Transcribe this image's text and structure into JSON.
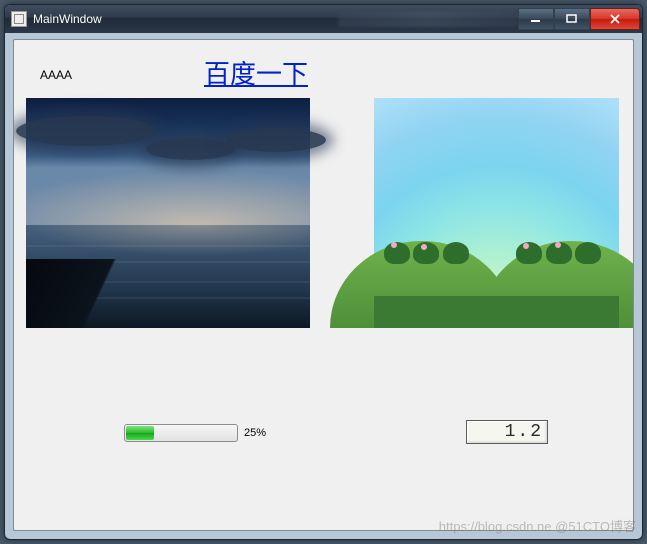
{
  "window": {
    "title": "MainWindow",
    "icons": {
      "app": "window-icon",
      "minimize": "minimize-icon",
      "maximize": "maximize-icon",
      "close": "close-icon"
    }
  },
  "labels": {
    "aaaa": "AAAA"
  },
  "link": {
    "text": "百度一下"
  },
  "images": {
    "left_alt": "sunset-over-water-photo",
    "right_alt": "cartoon-meadow-illustration"
  },
  "progress": {
    "value": 25,
    "max": 100,
    "text": "25%"
  },
  "lcd": {
    "value": "1.2"
  },
  "watermark": "https://blog.csdn.ne  @51CTO博客"
}
